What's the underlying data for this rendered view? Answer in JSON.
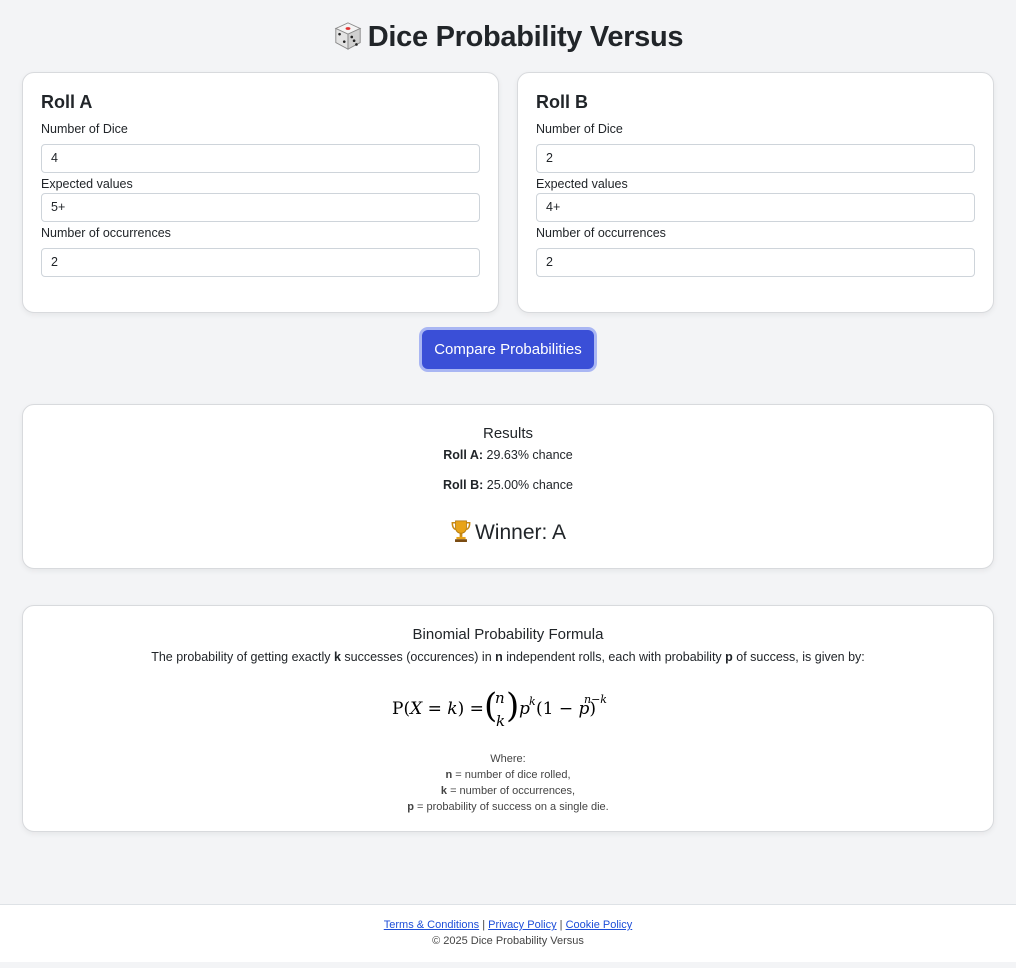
{
  "header": {
    "title": "Dice Probability Versus",
    "icon": "dice-icon"
  },
  "roll_a": {
    "title": "Roll A",
    "dice_label": "Number of Dice",
    "dice_value": "4",
    "expected_label": "Expected values",
    "expected_value": "5+",
    "occ_label": "Number of occurrences",
    "occ_value": "2"
  },
  "roll_b": {
    "title": "Roll B",
    "dice_label": "Number of Dice",
    "dice_value": "2",
    "expected_label": "Expected values",
    "expected_value": "4+",
    "occ_label": "Number of occurrences",
    "occ_value": "2"
  },
  "compare_button": "Compare Probabilities",
  "results": {
    "title": "Results",
    "a_label": "Roll A:",
    "a_value": "29.63% chance",
    "b_label": "Roll B:",
    "b_value": "25.00% chance",
    "winner": "Winner: A",
    "winner_icon": "trophy-icon"
  },
  "formula": {
    "title": "Binomial Probability Formula",
    "desc_1": "The probability of getting exactly ",
    "desc_k": "k",
    "desc_2": " successes (occurences) in ",
    "desc_n": "n",
    "desc_3": " independent rolls, each with probability ",
    "desc_p": "p",
    "desc_4": " of success, is given by:",
    "where": "Where:",
    "n_sym": "n",
    "n_def": " = number of dice rolled,",
    "k_sym": "k",
    "k_def": " = number of occurrences,",
    "p_sym": "p",
    "p_def": " = probability of success on a single die."
  },
  "footer": {
    "terms": "Terms & Conditions",
    "sep1": " | ",
    "privacy": "Privacy Policy",
    "sep2": " | ",
    "cookie": "Cookie Policy",
    "copyright": "© 2025 Dice Probability Versus"
  },
  "colors": {
    "primary": "#3a4fd7",
    "background": "#f3f4f6",
    "link": "#1d4ed8"
  }
}
